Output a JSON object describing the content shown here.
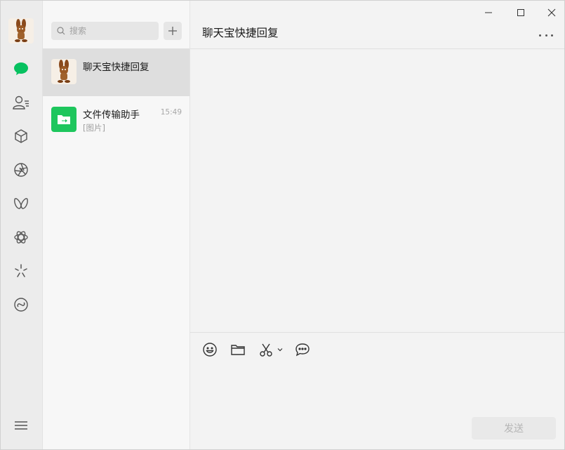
{
  "search": {
    "placeholder": "搜索"
  },
  "chats": [
    {
      "name": "聊天宝快捷回复",
      "time": "",
      "preview": ""
    },
    {
      "name": "文件传输助手",
      "time": "15:49",
      "preview": "[图片]"
    }
  ],
  "conversation": {
    "title": "聊天宝快捷回复"
  },
  "composer": {
    "send_label": "发送"
  },
  "colors": {
    "accent_green": "#07c160",
    "file_helper_green": "#1ec65d"
  }
}
